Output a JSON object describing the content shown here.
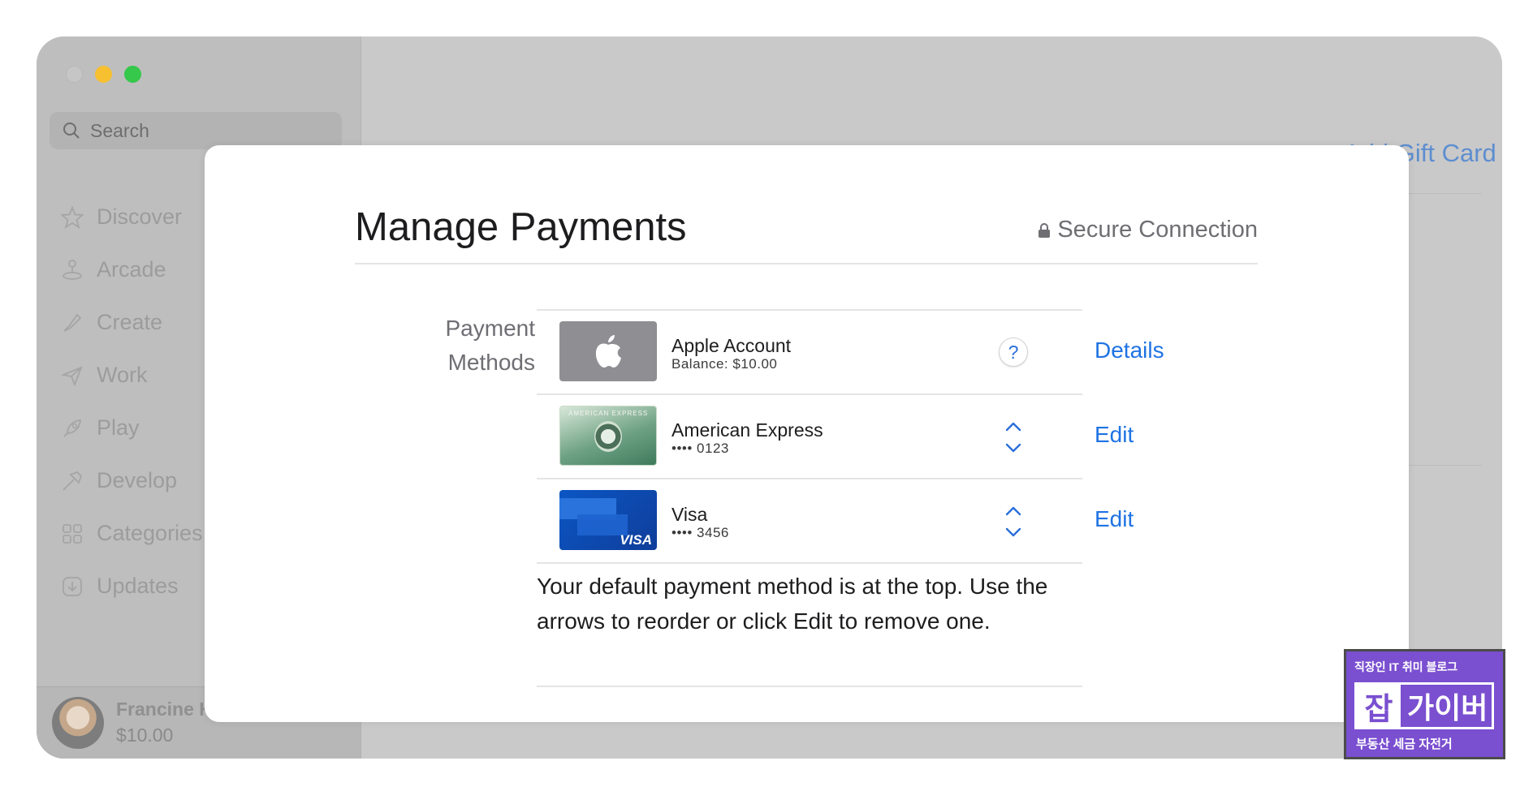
{
  "sidebar": {
    "search_label": "Search",
    "items": [
      {
        "label": "Discover",
        "icon": "star-icon"
      },
      {
        "label": "Arcade",
        "icon": "joystick-icon"
      },
      {
        "label": "Create",
        "icon": "brush-icon"
      },
      {
        "label": "Work",
        "icon": "paper-plane-icon"
      },
      {
        "label": "Play",
        "icon": "rocket-icon"
      },
      {
        "label": "Develop",
        "icon": "hammer-icon"
      },
      {
        "label": "Categories",
        "icon": "grid-icon"
      },
      {
        "label": "Updates",
        "icon": "download-icon"
      }
    ],
    "user": {
      "name": "Francine Hanson",
      "balance": "$10.00"
    }
  },
  "background": {
    "link_label": "Add Gift Card"
  },
  "dialog": {
    "title": "Manage Payments",
    "secure_label": "Secure Connection",
    "payment_methods_label": "Payment Methods",
    "methods": [
      {
        "name": "Apple Account",
        "detail": "Balance: $10.00",
        "action": "Details",
        "control": "help",
        "help_symbol": "?"
      },
      {
        "name": "American Express",
        "detail": "•••• 0123",
        "action": "Edit",
        "control": "reorder",
        "card_text": "AMERICAN EXPRESS"
      },
      {
        "name": "Visa",
        "detail": "•••• 3456",
        "action": "Edit",
        "control": "reorder",
        "card_text": "VISA"
      }
    ],
    "note": "Your default payment method is at the top. Use the arrows to reorder or click Edit to remove one."
  },
  "watermark": {
    "top": "직장인 IT 취미 블로그",
    "left": "잡",
    "right": "가이버",
    "bottom": "부동산 세금 자전거"
  },
  "colors": {
    "accent": "#1f73e3",
    "traffic_min": "#f6c030",
    "traffic_max": "#35c84a",
    "badge": "#7a4fd0"
  }
}
